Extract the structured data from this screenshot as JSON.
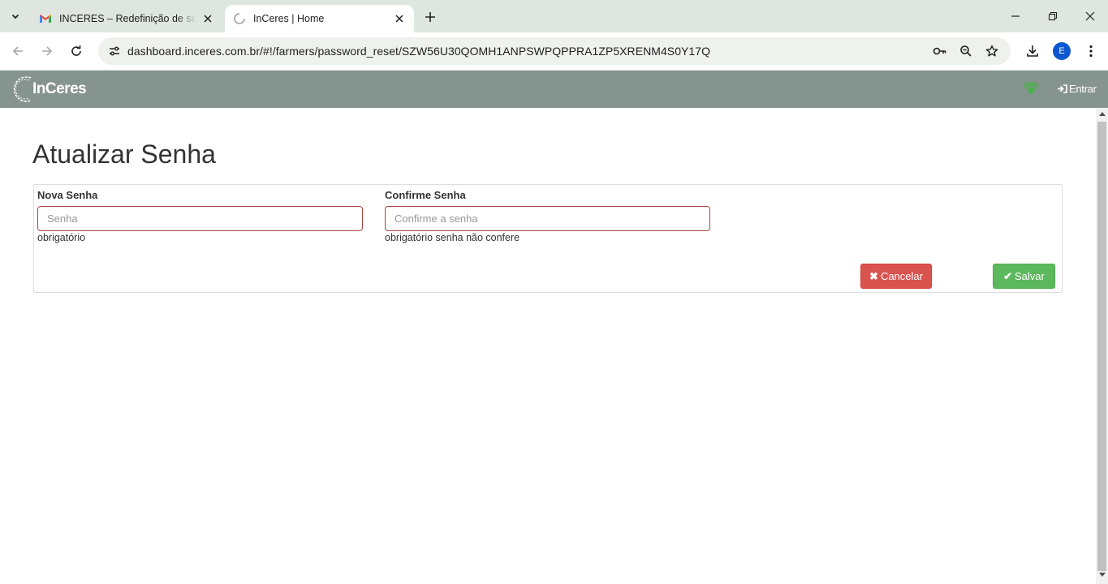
{
  "browser": {
    "tabs": [
      {
        "title": "INCERES – Redefinição de senha",
        "favicon": "gmail-icon",
        "active": false
      },
      {
        "title": "InCeres | Home",
        "favicon": "loading-spinner-icon",
        "active": true
      }
    ],
    "url": "dashboard.inceres.com.br/#!/farmers/password_reset/SZW56U30QOMH1ANPSWPQPPRA1ZP5XRENM4S0Y17Q",
    "profile_initial": "E"
  },
  "app": {
    "brand": "InCeres",
    "nav_color": "#86948f",
    "status_icon": "wifi-icon",
    "status_color": "#4caf50",
    "login_label": "Entrar"
  },
  "page": {
    "title": "Atualizar Senha",
    "form": {
      "new_password": {
        "label": "Nova Senha",
        "placeholder": "Senha",
        "value": "",
        "help": "obrigatório"
      },
      "confirm_password": {
        "label": "Confirme Senha",
        "placeholder": "Confirme a senha",
        "value": "",
        "help": "obrigatório senha não confere"
      },
      "error_color": "#a94442"
    },
    "actions": {
      "cancel_label": "Cancelar",
      "cancel_icon": "times-icon",
      "cancel_color": "#d9534f",
      "save_label": "Salvar",
      "save_icon": "check-icon",
      "save_color": "#5cb85c"
    }
  }
}
